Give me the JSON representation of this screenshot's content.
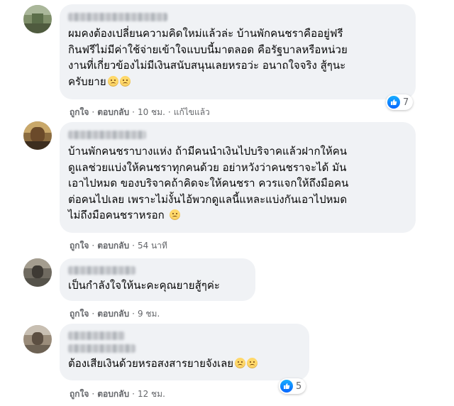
{
  "comments": [
    {
      "text": "ผมคงต้องเปลี่ยนความคิดใหม่แล้วล่ะ บ้านพักคนชราคืออยู่ฟรี\nกินฟรีไม่มีค่าใช้จ่ายเข้าใจแบบนี้มาตลอด คือรัฐบาลหรือหน่วย\nงานที่เกี่ยวข้องไม่มีเงินสนับสนุนเลยหรอว่ะ อนาถใจจริง สู้ๆนะ\nครับยาย",
      "like": "ถูกใจ",
      "reply": "ตอบกลับ",
      "time": "10 ชม.",
      "edited": "แก้ไขแล้ว",
      "reactions": "7"
    },
    {
      "text": "บ้านพักคนชราบางแห่ง ถ้ามีคนนำเงินไปบริจาคแล้วฝากให้คน\nดูแลช่วยแบ่งให้คนชราทุกคนด้วย อย่าหวังว่าคนชราจะได้ มัน\nเอาไปหมด ของบริจาคถ้าคิดจะให้คนชรา ควรแจกให้ถึงมือคน\nต่อคนไปเลย เพราะไม่งั้นไอ้พวกดูแลนี้แหละแบ่งกันเอาไปหมด\nไม่ถึงมือคนชราหรอก",
      "like": "ถูกใจ",
      "reply": "ตอบกลับ",
      "time": "54 นาที"
    },
    {
      "text": "เป็นกำลังใจให้นะคะคุณยายสู้ๆค่ะ",
      "like": "ถูกใจ",
      "reply": "ตอบกลับ",
      "time": "9 ชม."
    },
    {
      "text": "ต้องเสียเงินด้วยหรอสงสารยายจังเลย",
      "like": "ถูกใจ",
      "reply": "ตอบกลับ",
      "time": "12 ชม.",
      "reactions": "5"
    }
  ],
  "icons": {
    "reaction": "like-icon",
    "emoji": "sad-face-icon"
  },
  "colors": {
    "bubble": "#f0f2f5",
    "meta_text": "#65676b",
    "like_blue": "#1877f2"
  }
}
